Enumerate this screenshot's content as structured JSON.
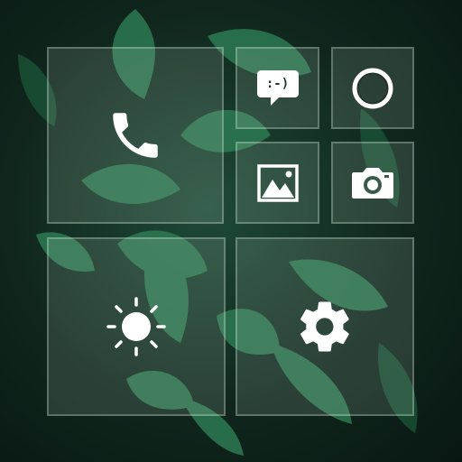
{
  "launcher": {
    "wallpaper": {
      "kind": "green leaves photo",
      "base_color": "#10261d",
      "leaf_color": "#2f7d56"
    },
    "tiles": [
      {
        "id": "phone",
        "icon": "phone-icon"
      },
      {
        "id": "messages",
        "icon": "chat-bubble-icon",
        "glyph": ":-)"
      },
      {
        "id": "ring",
        "icon": "circle-icon"
      },
      {
        "id": "gallery",
        "icon": "image-icon"
      },
      {
        "id": "camera",
        "icon": "camera-icon"
      },
      {
        "id": "brightness",
        "icon": "sun-icon"
      },
      {
        "id": "settings",
        "icon": "gear-icon"
      }
    ],
    "colors": {
      "tile_fill": "rgba(210,235,222,0.14)",
      "tile_border": "rgba(235,250,240,0.28)",
      "icon": "#ffffff"
    }
  }
}
